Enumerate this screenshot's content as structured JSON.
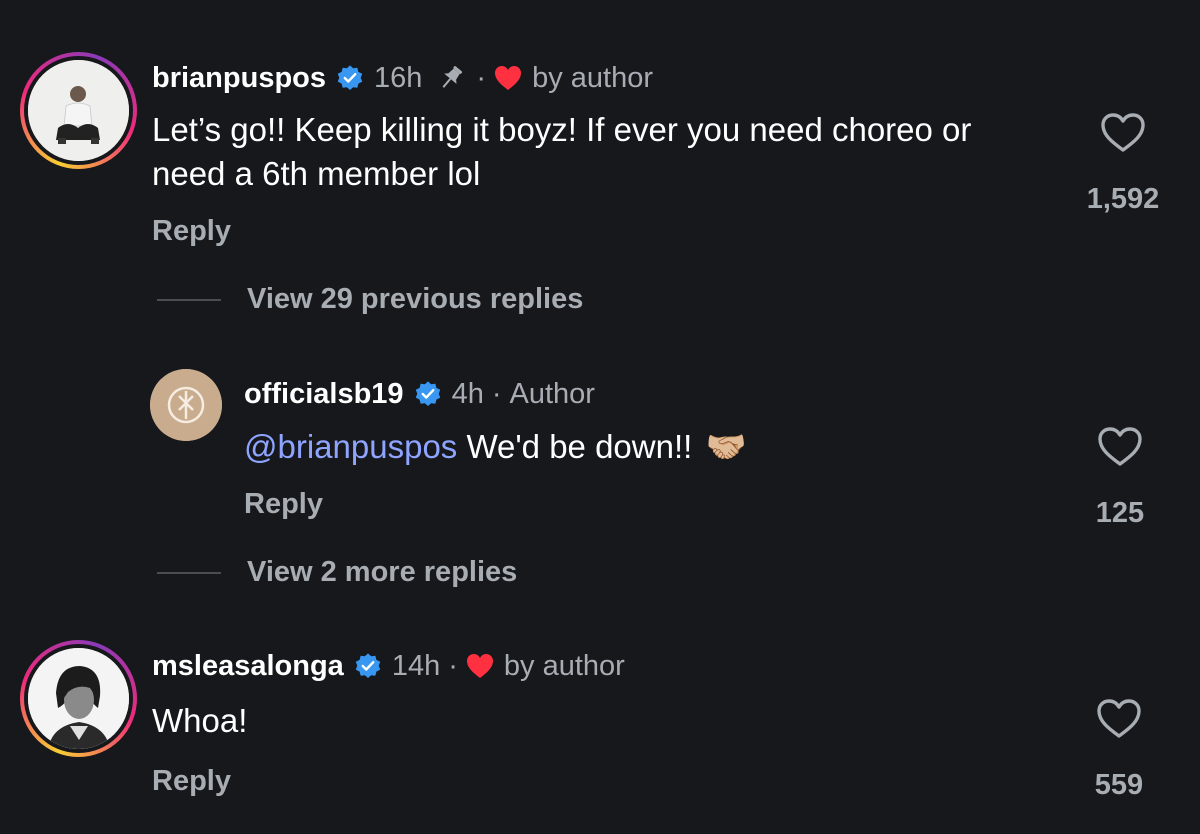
{
  "comments": [
    {
      "username": "brianpuspos",
      "time": "16h",
      "separator": "·",
      "byline": "by author",
      "text": "Let’s go!! Keep killing it boyz! If ever you need choreo or need a 6th member lol",
      "reply_label": "Reply",
      "likes": "1,592"
    },
    {
      "username": "msleasalonga",
      "time": "14h",
      "separator": "·",
      "byline": "by author",
      "text": "Whoa!",
      "reply_label": "Reply",
      "likes": "559"
    }
  ],
  "thread": {
    "view_previous": "View 29 previous replies",
    "view_more": "View 2 more replies"
  },
  "reply": {
    "username": "officialsb19",
    "time": "4h",
    "separator": "·",
    "tag": "Author",
    "mention": "@brianpuspos",
    "text": " We'd be down!!",
    "emoji": "🤝🏼",
    "reply_label": "Reply",
    "likes": "125"
  },
  "colors": {
    "background": "#16181c",
    "verified": "#3897f0",
    "like_red": "#ff3040",
    "mention": "#8ea4ff",
    "muted_text": "#a8acb3"
  }
}
